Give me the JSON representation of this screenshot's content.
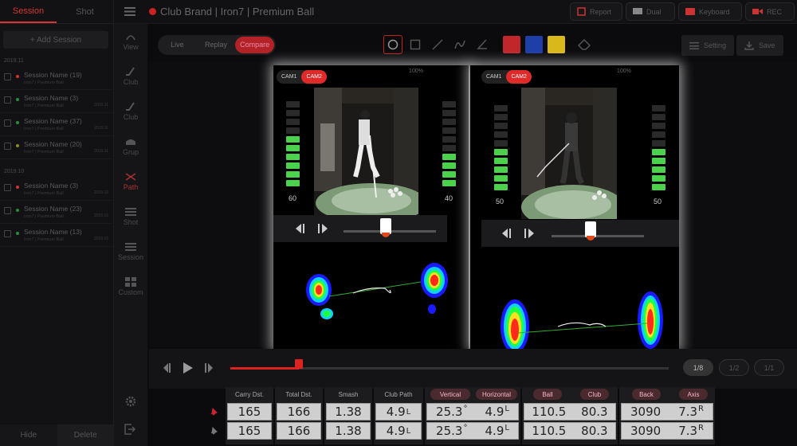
{
  "sidebar": {
    "tabs": [
      "Session",
      "Shot"
    ],
    "add_label": "+ Add Session",
    "groups": [
      {
        "label": "2019.11",
        "items": [
          {
            "name": "Session Name (19)",
            "sub": "Iron7 | Premium Ball",
            "date": "",
            "dot": "#c33"
          },
          {
            "name": "Session Name (3)",
            "sub": "Iron7 | Premium Ball",
            "date": "2019.11",
            "dot": "#2b8a3e"
          },
          {
            "name": "Session Name (37)",
            "sub": "Iron7 | Premium Ball",
            "date": "2019.11",
            "dot": "#2b8a3e"
          },
          {
            "name": "Session Name (20)",
            "sub": "Iron7 | Premium Ball",
            "date": "2019.11",
            "dot": "#8a8a2b"
          }
        ]
      },
      {
        "label": "2019.10",
        "items": [
          {
            "name": "Session Name (3)",
            "sub": "Iron7 | Premium Ball",
            "date": "2019.10",
            "dot": "#c33"
          },
          {
            "name": "Session Name (23)",
            "sub": "Iron7 | Premium Ball",
            "date": "2019.10",
            "dot": "#2b8a3e"
          },
          {
            "name": "Session Name (13)",
            "sub": "Iron7 | Premium Ball",
            "date": "2019.10",
            "dot": "#2b8a3e"
          }
        ]
      }
    ],
    "hide_label": "Hide",
    "delete_label": "Delete"
  },
  "iconbar": [
    {
      "label": "View",
      "icon": "view-icon"
    },
    {
      "label": "Club",
      "icon": "club-icon"
    },
    {
      "label": "Club",
      "icon": "club-icon"
    },
    {
      "label": "Grup",
      "icon": "grip-icon"
    },
    {
      "label": "Path",
      "icon": "path-icon"
    },
    {
      "label": "Shot",
      "icon": "list-icon"
    },
    {
      "label": "Session",
      "icon": "list-icon"
    },
    {
      "label": "Custom",
      "icon": "grid-icon"
    }
  ],
  "header": {
    "title": "Club Brand | Iron7 | Premium Ball",
    "buttons": [
      "Report",
      "Dual",
      "Keyboard",
      "REC"
    ]
  },
  "mode": {
    "options": [
      "Live",
      "Replay",
      "Compare"
    ],
    "selected": "Compare"
  },
  "colors": {
    "accent": "#e02a2a",
    "swatch_red": "#c0262c",
    "swatch_blue": "#1e3ea8",
    "swatch_yellow": "#d9b81c"
  },
  "right_buttons": [
    "Setting",
    "Save"
  ],
  "panels": [
    {
      "cams": [
        "CAM1",
        "CAM2"
      ],
      "active_cam": "CAM2",
      "zoom": "100%",
      "left_value": "60",
      "right_value": "40",
      "left_level": 0.6,
      "right_level": 0.4
    },
    {
      "cams": [
        "CAM1",
        "CAM2"
      ],
      "active_cam": "CAM2",
      "zoom": "100%",
      "left_value": "50",
      "right_value": "50",
      "left_level": 0.5,
      "right_level": 0.5
    }
  ],
  "playback": {
    "pages": [
      "1/8",
      "1/2",
      "1/1"
    ],
    "active_page": "1/8",
    "progress": 0.16
  },
  "data_table": {
    "headers": [
      "Carry Dst.",
      "Total Dst.",
      "Smash",
      "Club Path",
      "Vertical",
      "Horizontal",
      "Ball",
      "Club",
      "Back",
      "Axis"
    ],
    "rows": [
      [
        "165",
        "166",
        "1.38",
        "4.9",
        "L",
        "25.3",
        "°",
        "4.9",
        "L",
        "110.5",
        "80.3",
        "3090",
        "7.3",
        "R"
      ],
      [
        "165",
        "166",
        "1.38",
        "4.9",
        "L",
        "25.3",
        "°",
        "4.9",
        "L",
        "110.5",
        "80.3",
        "3090",
        "7.3",
        "R"
      ]
    ]
  }
}
